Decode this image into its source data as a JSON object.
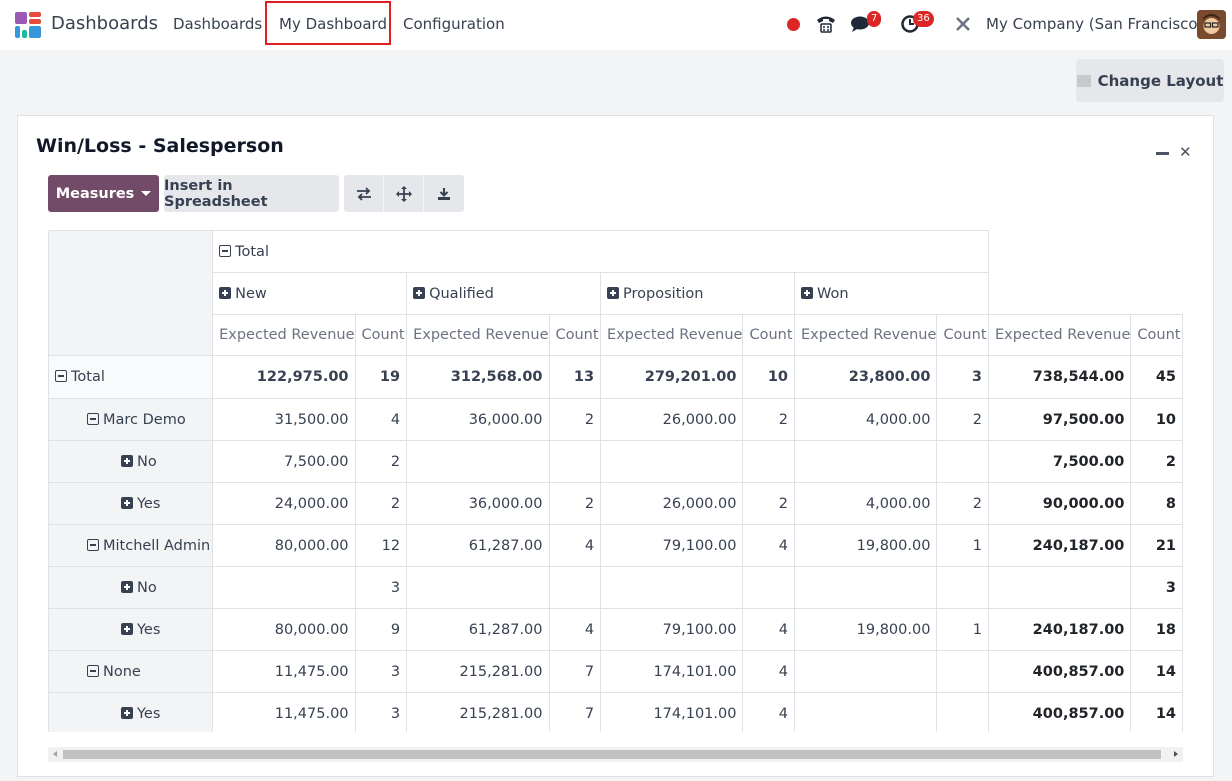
{
  "navbar": {
    "app_name": "Dashboards",
    "menu": [
      "Dashboards",
      "My Dashboard",
      "Configuration"
    ],
    "messages_badge": "7",
    "activities_badge": "36",
    "company": "My Company (San Francisco)"
  },
  "page": {
    "change_layout_label": "Change Layout"
  },
  "card": {
    "title": "Win/Loss - Salesperson",
    "toolbar": {
      "measures_label": "Measures",
      "insert_label": "Insert in Spreadsheet"
    }
  },
  "pivot": {
    "col_total_label": "Total",
    "stages": [
      "New",
      "Qualified",
      "Proposition",
      "Won"
    ],
    "measures": [
      "Expected Revenue",
      "Count"
    ],
    "rows": [
      {
        "label": "Total",
        "level": 0,
        "toggle": "minus",
        "cells": [
          "122,975.00",
          "19",
          "312,568.00",
          "13",
          "279,201.00",
          "10",
          "23,800.00",
          "3",
          "738,544.00",
          "45"
        ]
      },
      {
        "label": "Marc Demo",
        "level": 1,
        "toggle": "minus",
        "cells": [
          "31,500.00",
          "4",
          "36,000.00",
          "2",
          "26,000.00",
          "2",
          "4,000.00",
          "2",
          "97,500.00",
          "10"
        ]
      },
      {
        "label": "No",
        "level": 2,
        "toggle": "plus",
        "cells": [
          "7,500.00",
          "2",
          "",
          "",
          "",
          "",
          "",
          "",
          "7,500.00",
          "2"
        ]
      },
      {
        "label": "Yes",
        "level": 2,
        "toggle": "plus",
        "cells": [
          "24,000.00",
          "2",
          "36,000.00",
          "2",
          "26,000.00",
          "2",
          "4,000.00",
          "2",
          "90,000.00",
          "8"
        ]
      },
      {
        "label": "Mitchell Admin",
        "level": 1,
        "toggle": "minus",
        "cells": [
          "80,000.00",
          "12",
          "61,287.00",
          "4",
          "79,100.00",
          "4",
          "19,800.00",
          "1",
          "240,187.00",
          "21"
        ]
      },
      {
        "label": "No",
        "level": 2,
        "toggle": "plus",
        "cells": [
          "",
          "3",
          "",
          "",
          "",
          "",
          "",
          "",
          "",
          "3"
        ]
      },
      {
        "label": "Yes",
        "level": 2,
        "toggle": "plus",
        "cells": [
          "80,000.00",
          "9",
          "61,287.00",
          "4",
          "79,100.00",
          "4",
          "19,800.00",
          "1",
          "240,187.00",
          "18"
        ]
      },
      {
        "label": "None",
        "level": 1,
        "toggle": "minus",
        "cells": [
          "11,475.00",
          "3",
          "215,281.00",
          "7",
          "174,101.00",
          "4",
          "",
          "",
          "400,857.00",
          "14"
        ]
      },
      {
        "label": "Yes",
        "level": 2,
        "toggle": "plus",
        "cells": [
          "11,475.00",
          "3",
          "215,281.00",
          "7",
          "174,101.00",
          "4",
          "",
          "",
          "400,857.00",
          "14"
        ]
      }
    ]
  }
}
